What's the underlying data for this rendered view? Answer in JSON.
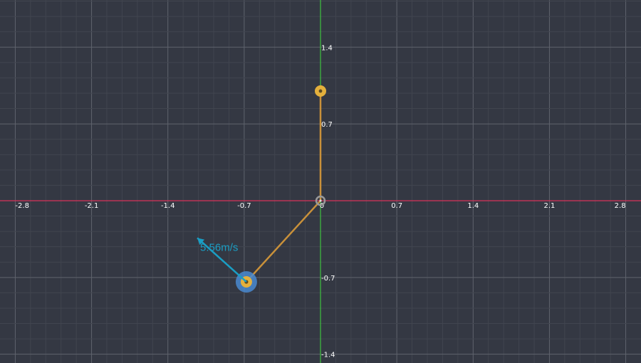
{
  "colors": {
    "background": "#343843",
    "grid_minor": "#41454f",
    "grid_major": "#5f636d",
    "x_axis": "#d8325a",
    "y_axis": "#3fc23f",
    "rod": "#c9913a",
    "pivot": "#9a9a9a",
    "joint": "#e4b03c",
    "bob_outer": "#4a8ad0",
    "velocity": "#1a9ec4"
  },
  "axes": {
    "x_ticks": [
      "-2.8",
      "-2.1",
      "-1.4",
      "-0.7",
      "0",
      "0.7",
      "1.4",
      "2.1",
      "2.8"
    ],
    "y_ticks": [
      "1.4",
      "0.7",
      "-0.7",
      "-1.4"
    ],
    "x_range": [
      -2.94,
      2.94
    ],
    "y_range": [
      -1.48,
      1.83
    ]
  },
  "simulation": {
    "pivot": {
      "x": 0,
      "y": 0,
      "icon": "pivot-icon"
    },
    "joint": {
      "x": 0,
      "y": 1.0,
      "icon": "joint-handle-icon"
    },
    "bob": {
      "x": -0.68,
      "y": -0.74,
      "icon": "bob-icon"
    },
    "velocity": {
      "dx": -0.45,
      "dy": 0.4,
      "label": "5.56m/s",
      "icon": "velocity-arrow-icon"
    }
  }
}
